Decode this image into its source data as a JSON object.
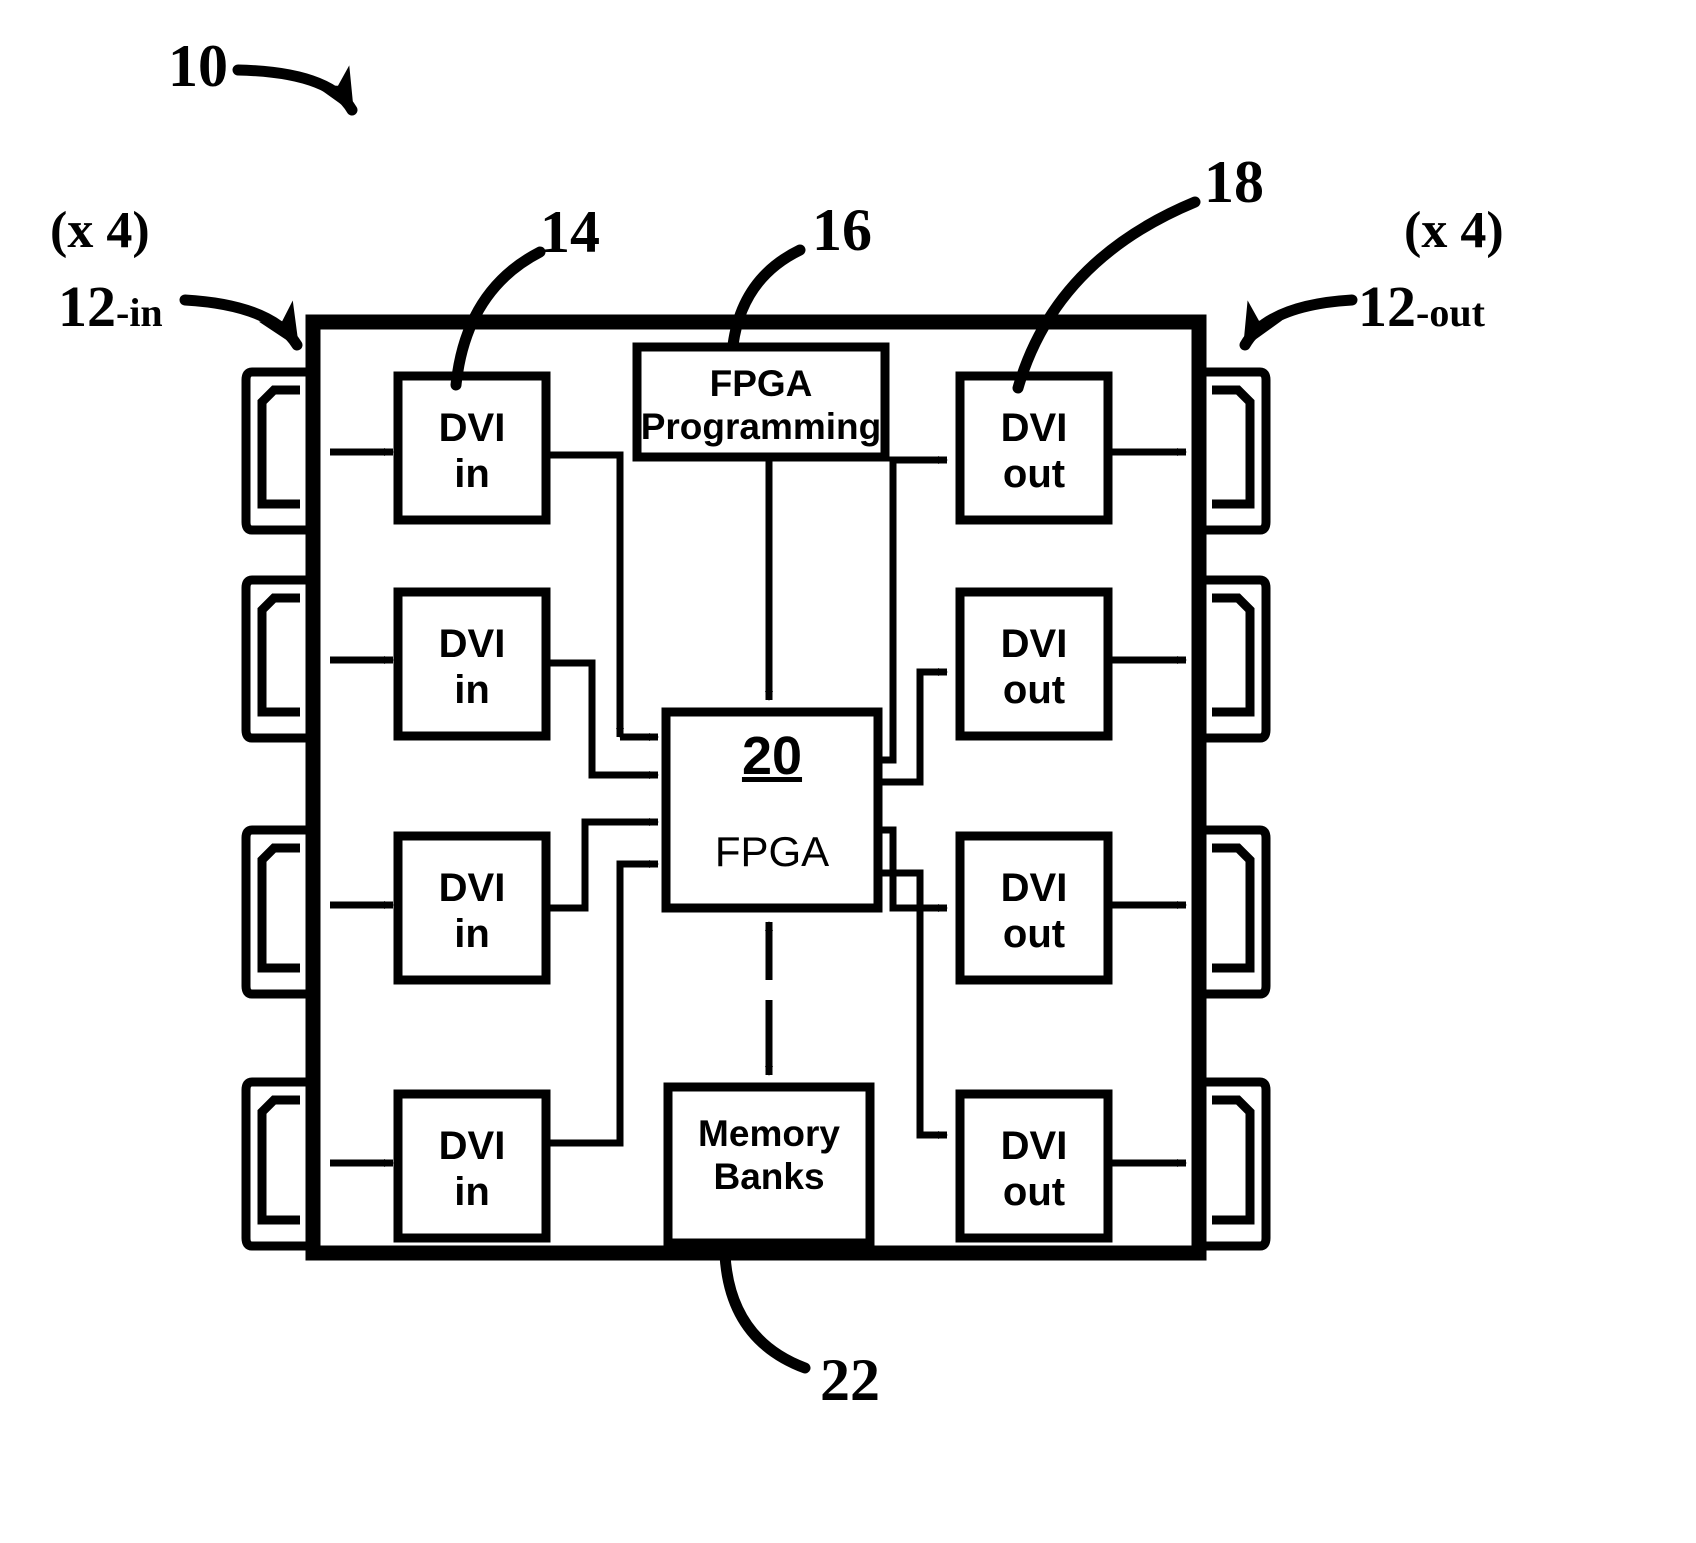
{
  "figure": {
    "type": "patent-block-diagram",
    "subject": "DVI video processing board with FPGA",
    "background": "#ffffff",
    "ink": "#000000"
  },
  "callouts": {
    "system": "10",
    "dvi_in_block": "14",
    "fpga_programming_block": "16",
    "dvi_out_block": "18",
    "fpga_block": "20",
    "memory_banks_block": "22",
    "input_connector": "12-in",
    "input_connector_base": "12",
    "input_connector_suffix": "-in",
    "output_connector": "12-out",
    "output_connector_base": "12",
    "output_connector_suffix": "-out",
    "input_multiplicity": "(x 4)",
    "output_multiplicity": "(x 4)"
  },
  "blocks": {
    "dvi_in": {
      "line1": "DVI",
      "line2": "in",
      "count": 4
    },
    "dvi_out": {
      "line1": "DVI",
      "line2": "out",
      "count": 4
    },
    "fpga_programming": {
      "line1": "FPGA",
      "line2": "Programming"
    },
    "fpga": {
      "ref": "20",
      "label": "FPGA"
    },
    "memory_banks": {
      "line1": "Memory",
      "line2": "Banks"
    }
  },
  "connectors": {
    "left": [
      {
        "name": "dvi-input-connector-1"
      },
      {
        "name": "dvi-input-connector-2"
      },
      {
        "name": "dvi-input-connector-3"
      },
      {
        "name": "dvi-input-connector-4"
      }
    ],
    "right": [
      {
        "name": "dvi-output-connector-1"
      },
      {
        "name": "dvi-output-connector-2"
      },
      {
        "name": "dvi-output-connector-3"
      },
      {
        "name": "dvi-output-connector-4"
      }
    ]
  }
}
